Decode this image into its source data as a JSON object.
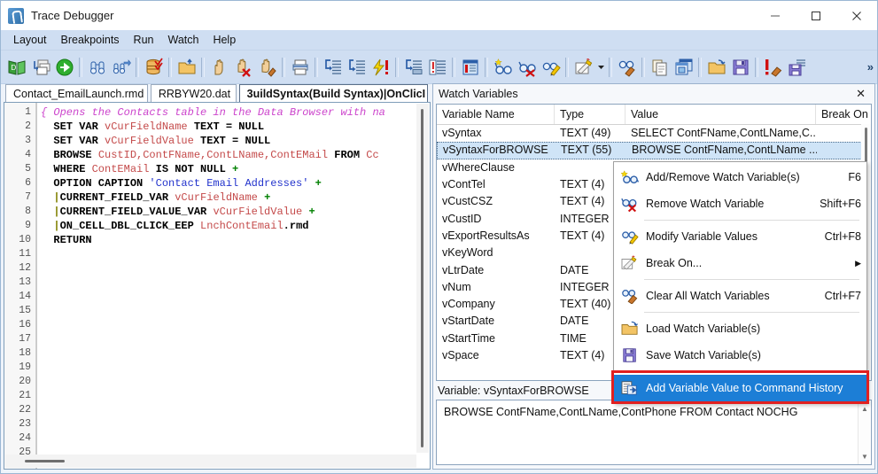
{
  "window": {
    "title": "Trace Debugger",
    "icon": "app-logo-icon",
    "minimize": "–",
    "maximize": "▢",
    "close": "✕"
  },
  "menubar": {
    "items": [
      {
        "label": "Layout"
      },
      {
        "label": "Breakpoints"
      },
      {
        "label": "Run"
      },
      {
        "label": "Watch"
      },
      {
        "label": "Help"
      }
    ]
  },
  "toolbar": {
    "overflow_label": "»",
    "groups": [
      {
        "buttons": [
          {
            "icon": "open-book-icon"
          },
          {
            "icon": "copy-windows-icon"
          },
          {
            "icon": "go-run-icon"
          }
        ]
      },
      {
        "buttons": [
          {
            "icon": "find-binoculars-icon"
          },
          {
            "icon": "find-next-binoculars-icon"
          }
        ]
      },
      {
        "buttons": [
          {
            "icon": "database-check-icon"
          }
        ]
      },
      {
        "buttons": [
          {
            "icon": "open-folder-up-icon"
          }
        ]
      },
      {
        "buttons": [
          {
            "icon": "hand-pause-icon"
          },
          {
            "icon": "hand-stop-red-x-icon"
          },
          {
            "icon": "hand-clear-brush-icon"
          }
        ]
      },
      {
        "buttons": [
          {
            "icon": "print-icon"
          }
        ]
      },
      {
        "buttons": [
          {
            "icon": "step-into-icon"
          },
          {
            "icon": "step-over-icon"
          },
          {
            "icon": "lightning-break-icon"
          }
        ]
      },
      {
        "buttons": [
          {
            "icon": "step-out-icon"
          },
          {
            "icon": "run-to-cursor-icon"
          }
        ]
      },
      {
        "buttons": [
          {
            "icon": "command-history-icon"
          }
        ]
      },
      {
        "buttons": [
          {
            "icon": "add-watch-glasses-icon"
          },
          {
            "icon": "remove-watch-glasses-icon"
          },
          {
            "icon": "modify-watch-pencil-icon"
          }
        ]
      },
      {
        "buttons": [
          {
            "icon": "break-on-pencil-icon"
          },
          {
            "icon": "break-on-dropdown-icon"
          }
        ]
      },
      {
        "buttons": [
          {
            "icon": "clear-watch-brush-icon"
          }
        ]
      },
      {
        "buttons": [
          {
            "icon": "copy-page-icon"
          },
          {
            "icon": "window-stack-icon"
          }
        ]
      },
      {
        "buttons": [
          {
            "icon": "load-folder-icon"
          },
          {
            "icon": "save-floppy-icon"
          }
        ]
      },
      {
        "buttons": [
          {
            "icon": "clear-breakpoints-icon"
          },
          {
            "icon": "save-list-floppy-icon"
          }
        ]
      }
    ]
  },
  "editor": {
    "tabs": [
      {
        "label": "Contact_EmailLaunch.rmd",
        "active": false
      },
      {
        "label": "RRBYW20.dat",
        "active": false
      },
      {
        "label": "3uildSyntax(Build Syntax)|OnClicI",
        "active": true
      }
    ],
    "line_numbers": [
      1,
      2,
      3,
      4,
      5,
      6,
      7,
      8,
      9,
      10,
      11,
      12,
      13,
      14,
      15,
      16,
      17,
      18,
      19,
      20,
      21,
      22,
      23,
      24,
      25
    ],
    "lines": [
      {
        "n": 1,
        "tokens": [
          {
            "t": "{ Opens the Contacts table in the Data Browser with na",
            "c": "cmt"
          }
        ]
      },
      {
        "n": 2,
        "tokens": [
          {
            "t": "  SET VAR ",
            "c": "kw"
          },
          {
            "t": "vCurFieldName",
            "c": "id"
          },
          {
            "t": " TEXT = NULL",
            "c": "kw"
          }
        ]
      },
      {
        "n": 3,
        "tokens": [
          {
            "t": "  SET VAR ",
            "c": "kw"
          },
          {
            "t": "vCurFieldValue",
            "c": "id"
          },
          {
            "t": " TEXT = NULL",
            "c": "kw"
          }
        ]
      },
      {
        "n": 4,
        "tokens": [
          {
            "t": "  BROWSE ",
            "c": "kw"
          },
          {
            "t": "CustID,ContFName,ContLName,ContEMail",
            "c": "id"
          },
          {
            "t": " FROM ",
            "c": "kw"
          },
          {
            "t": "Cc",
            "c": "id"
          }
        ]
      },
      {
        "n": 5,
        "tokens": [
          {
            "t": "  WHERE ",
            "c": "kw"
          },
          {
            "t": "ContEMail",
            "c": "id"
          },
          {
            "t": " IS NOT NULL ",
            "c": "kw"
          },
          {
            "t": "+",
            "c": "plus"
          }
        ]
      },
      {
        "n": 6,
        "tokens": [
          {
            "t": "  OPTION CAPTION ",
            "c": "kw"
          },
          {
            "t": "'Contact Email Addresses'",
            "c": "str"
          },
          {
            "t": " ",
            "c": "kw"
          },
          {
            "t": "+",
            "c": "plus"
          }
        ]
      },
      {
        "n": 7,
        "tokens": [
          {
            "t": "  |",
            "c": "pipe"
          },
          {
            "t": "CURRENT_FIELD_VAR ",
            "c": "kw"
          },
          {
            "t": "vCurFieldName",
            "c": "id"
          },
          {
            "t": " ",
            "c": "kw"
          },
          {
            "t": "+",
            "c": "plus"
          }
        ]
      },
      {
        "n": 8,
        "tokens": [
          {
            "t": "  |",
            "c": "pipe"
          },
          {
            "t": "CURRENT_FIELD_VALUE_VAR ",
            "c": "kw"
          },
          {
            "t": "vCurFieldValue",
            "c": "id"
          },
          {
            "t": " ",
            "c": "kw"
          },
          {
            "t": "+",
            "c": "plus"
          }
        ]
      },
      {
        "n": 9,
        "tokens": [
          {
            "t": "  |",
            "c": "pipe"
          },
          {
            "t": "ON_CELL_DBL_CLICK_EEP ",
            "c": "kw"
          },
          {
            "t": "LnchContEmail",
            "c": "id"
          },
          {
            "t": ".rmd",
            "c": "kw"
          }
        ]
      },
      {
        "n": 10,
        "tokens": [
          {
            "t": "  RETURN",
            "c": "kw"
          }
        ]
      }
    ]
  },
  "watch_panel": {
    "title": "Watch Variables",
    "close_label": "✕",
    "columns": [
      "Variable Name",
      "Type",
      "Value",
      "Break On"
    ],
    "rows": [
      {
        "name": "vSyntax",
        "type": "TEXT (49)",
        "value": "SELECT ContFName,ContLName,C...",
        "break_on": "",
        "selected": false
      },
      {
        "name": "vSyntaxForBROWSE",
        "type": "TEXT (55)",
        "value": "BROWSE ContFName,ContLName ...",
        "break_on": "",
        "selected": true
      },
      {
        "name": "vWhereClause",
        "type": "",
        "value": "",
        "break_on": "",
        "selected": false
      },
      {
        "name": "vContTel",
        "type": "TEXT (4)",
        "value": "",
        "break_on": "",
        "selected": false
      },
      {
        "name": "vCustCSZ",
        "type": "TEXT (4)",
        "value": "",
        "break_on": "",
        "selected": false
      },
      {
        "name": "vCustID",
        "type": "INTEGER",
        "value": "",
        "break_on": "",
        "selected": false
      },
      {
        "name": "vExportResultsAs",
        "type": "TEXT (4)",
        "value": "",
        "break_on": "",
        "selected": false
      },
      {
        "name": "vKeyWord",
        "type": "",
        "value": "",
        "break_on": "",
        "selected": false
      },
      {
        "name": "vLtrDate",
        "type": "DATE",
        "value": "",
        "break_on": "",
        "selected": false
      },
      {
        "name": "vNum",
        "type": "INTEGER",
        "value": "",
        "break_on": "",
        "selected": false
      },
      {
        "name": "vCompany",
        "type": "TEXT (40)",
        "value": "",
        "break_on": "",
        "selected": false
      },
      {
        "name": "vStartDate",
        "type": "DATE",
        "value": "",
        "break_on": "",
        "selected": false
      },
      {
        "name": "vStartTime",
        "type": "TIME",
        "value": "",
        "break_on": "",
        "selected": false
      },
      {
        "name": "vSpace",
        "type": "TEXT (4)",
        "value": "",
        "break_on": "",
        "selected": false
      }
    ]
  },
  "context_menu": {
    "items": [
      {
        "label": "Add/Remove Watch Variable(s)",
        "accel": "F6",
        "icon": "add-remove-watch-glasses-icon",
        "highlighted": false,
        "submenu": false
      },
      {
        "label": "Remove Watch Variable",
        "accel": "Shift+F6",
        "icon": "remove-watch-glasses-red-x-icon",
        "highlighted": false,
        "submenu": false
      },
      {
        "separator": true
      },
      {
        "label": "Modify Variable Values",
        "accel": "Ctrl+F8",
        "icon": "modify-watch-pencil-icon",
        "highlighted": false,
        "submenu": false
      },
      {
        "label": "Break On...",
        "accel": "",
        "icon": "break-on-pencil-icon",
        "highlighted": false,
        "submenu": true,
        "submenu_arrow": "▶"
      },
      {
        "separator": true
      },
      {
        "label": "Clear All Watch Variables",
        "accel": "Ctrl+F7",
        "icon": "clear-watch-brush-icon",
        "highlighted": false,
        "submenu": false
      },
      {
        "separator": true
      },
      {
        "label": "Load Watch Variable(s)",
        "accel": "",
        "icon": "load-folder-icon",
        "highlighted": false,
        "submenu": false
      },
      {
        "label": "Save Watch Variable(s)",
        "accel": "",
        "icon": "save-floppy-icon",
        "highlighted": false,
        "submenu": false
      },
      {
        "separator": true
      },
      {
        "label": "Add Variable Value to Command History",
        "accel": "",
        "icon": "command-history-page-icon",
        "highlighted": true,
        "submenu": false
      }
    ],
    "highlight_color": "#1c7ed6",
    "annotation_box_color": "#e02020"
  },
  "variable_detail": {
    "label": "Variable: vSyntaxForBROWSE",
    "value": "BROWSE ContFName,ContLName,ContPhone FROM Contact NOCHG",
    "scroll_up": "▲",
    "scroll_down": "▼"
  }
}
